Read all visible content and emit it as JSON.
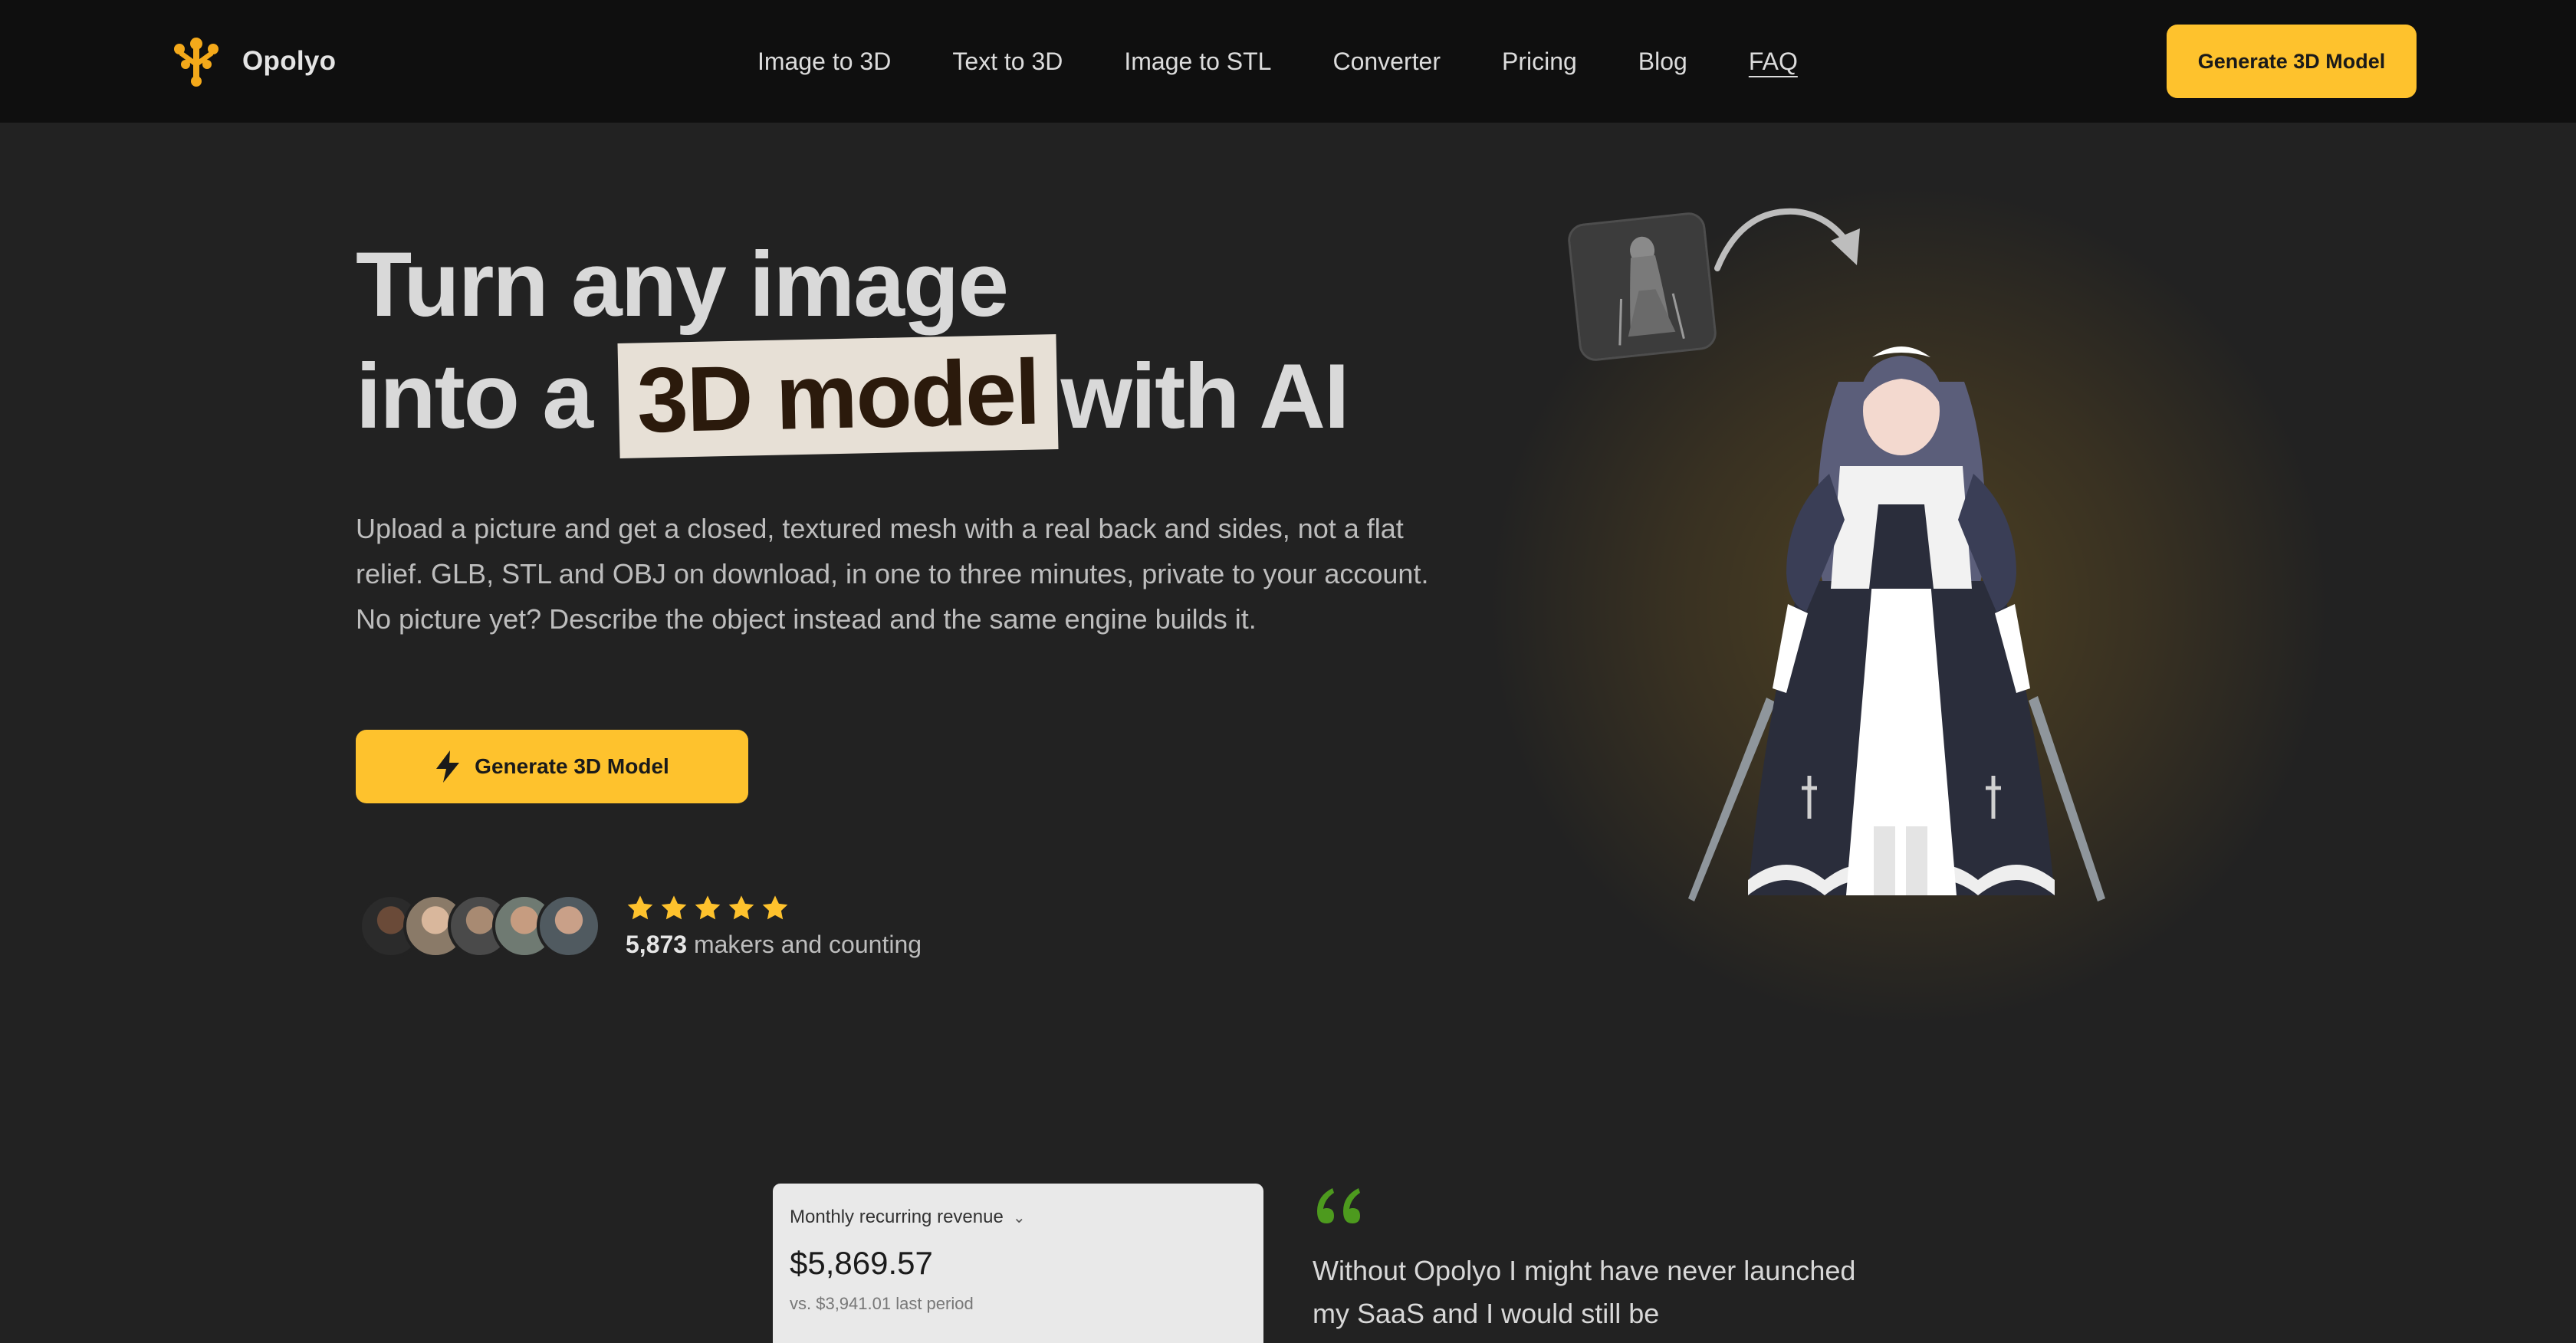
{
  "nav": {
    "brand": "Opolyo",
    "links": [
      "Image to 3D",
      "Text to 3D",
      "Image to STL",
      "Converter",
      "Pricing",
      "Blog",
      "FAQ"
    ],
    "cta": "Generate 3D Model"
  },
  "hero": {
    "title_line1": "Turn any image",
    "title_prefix": "into a",
    "title_highlight": "3D model",
    "title_suffix": "with AI",
    "description": "Upload a picture and get a closed, textured mesh with a real back and sides, not a flat relief. GLB, STL and OBJ on download, in one to three minutes, private to your account. No picture yet? Describe the object instead and the same engine builds it.",
    "cta": "Generate 3D Model",
    "rating": 5,
    "makers_count": "5,873",
    "makers_text": "makers and counting"
  },
  "revenue_card": {
    "label": "Monthly recurring revenue",
    "value": "$5,869.57",
    "compare": "vs. $3,941.01 last period"
  },
  "testimonial": {
    "text": "Without Opolyo I might have never launched my SaaS and I would still be"
  },
  "colors": {
    "accent": "#fec22d",
    "nav_bg": "#0f0f0f",
    "page_bg": "#222222",
    "highlight_bg": "#e7e0d6",
    "quote": "#4d9a1e"
  }
}
